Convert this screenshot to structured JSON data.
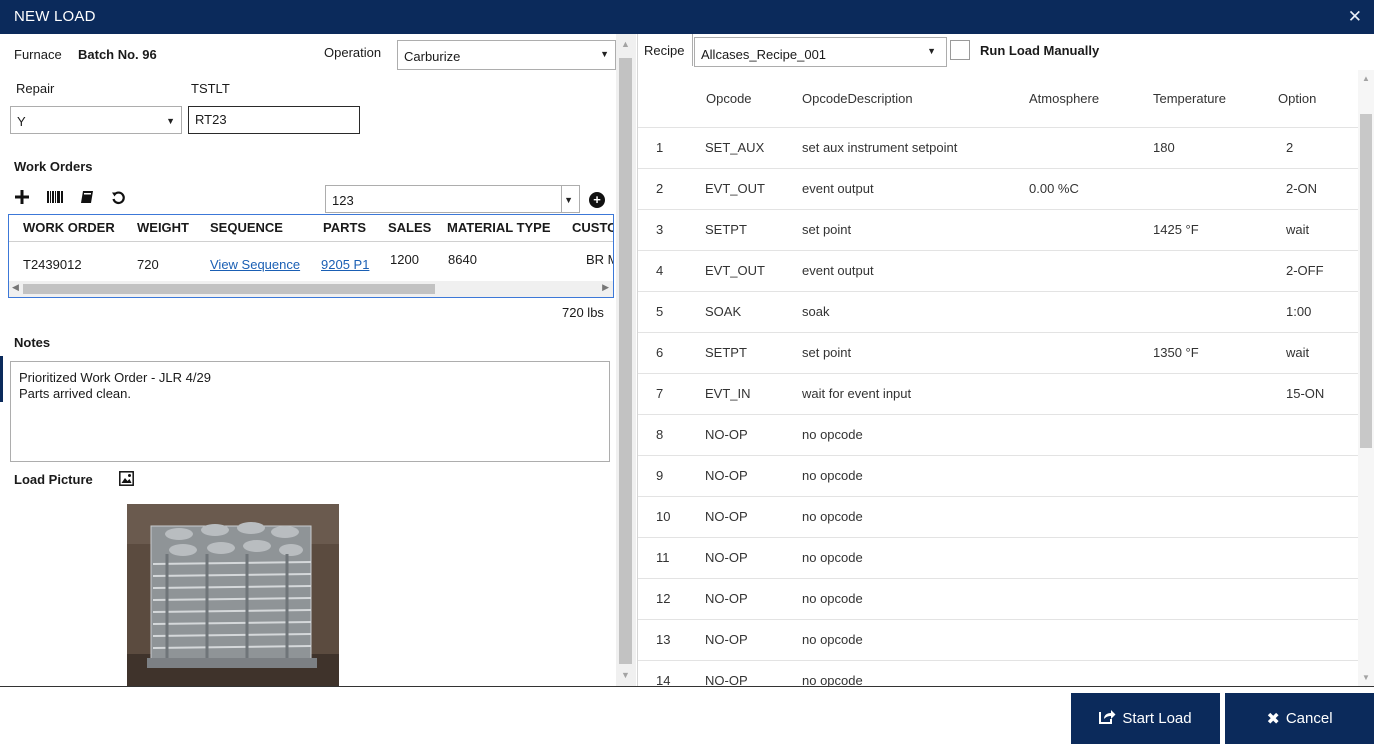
{
  "window": {
    "title": "NEW LOAD",
    "close_glyph": "✕"
  },
  "header": {
    "furnace_label": "Furnace",
    "batch": "Batch No. 96",
    "operation_label": "Operation",
    "operation_value": "Carburize",
    "repair_label": "Repair",
    "repair_value": "Y",
    "tstlt_label": "TSTLT",
    "tstlt_value": "RT23"
  },
  "work_orders": {
    "heading": "Work Orders",
    "toolbar_icons": [
      "add-icon",
      "barcode-icon",
      "book-icon",
      "refresh-icon"
    ],
    "search_value": "123",
    "columns": [
      "WORK ORDER",
      "WEIGHT",
      "SEQUENCE",
      "PARTS",
      "SALES",
      "MATERIAL TYPE",
      "CUSTO"
    ],
    "row": {
      "work_order": "T2439012",
      "weight": "720",
      "sequence": "View Sequence",
      "parts": "9205 P1",
      "sales": "1200",
      "material_type": "8640",
      "customer": "BR Ma"
    },
    "total_weight": "720 lbs"
  },
  "notes": {
    "heading": "Notes",
    "line1": "Prioritized Work Order - JLR 4/29",
    "line2": "Parts arrived clean."
  },
  "load_picture": {
    "heading": "Load Picture",
    "icon": "image-icon"
  },
  "recipe": {
    "label": "Recipe",
    "value": "Allcases_Recipe_001",
    "run_manual_label": "Run Load Manually",
    "run_manual_checked": false
  },
  "opcodes": {
    "columns": [
      "Opcode",
      "OpcodeDescription",
      "Atmosphere",
      "Temperature",
      "Option"
    ],
    "rows": [
      {
        "n": "1",
        "opcode": "SET_AUX",
        "desc": "set aux instrument setpoint",
        "atm": "",
        "temp": "180",
        "option": "2"
      },
      {
        "n": "2",
        "opcode": "EVT_OUT",
        "desc": "event output",
        "atm": "0.00 %C",
        "temp": "",
        "option": "2-ON"
      },
      {
        "n": "3",
        "opcode": "SETPT",
        "desc": "set point",
        "atm": "",
        "temp": "1425 °F",
        "option": "wait"
      },
      {
        "n": "4",
        "opcode": "EVT_OUT",
        "desc": "event output",
        "atm": "",
        "temp": "",
        "option": "2-OFF"
      },
      {
        "n": "5",
        "opcode": "SOAK",
        "desc": "soak",
        "atm": "",
        "temp": "",
        "option": "1:00"
      },
      {
        "n": "6",
        "opcode": "SETPT",
        "desc": "set point",
        "atm": "",
        "temp": "1350 °F",
        "option": "wait"
      },
      {
        "n": "7",
        "opcode": "EVT_IN",
        "desc": "wait for event input",
        "atm": "",
        "temp": "",
        "option": "15-ON"
      },
      {
        "n": "8",
        "opcode": "NO-OP",
        "desc": "no opcode",
        "atm": "",
        "temp": "",
        "option": ""
      },
      {
        "n": "9",
        "opcode": "NO-OP",
        "desc": "no opcode",
        "atm": "",
        "temp": "",
        "option": ""
      },
      {
        "n": "10",
        "opcode": "NO-OP",
        "desc": "no opcode",
        "atm": "",
        "temp": "",
        "option": ""
      },
      {
        "n": "11",
        "opcode": "NO-OP",
        "desc": "no opcode",
        "atm": "",
        "temp": "",
        "option": ""
      },
      {
        "n": "12",
        "opcode": "NO-OP",
        "desc": "no opcode",
        "atm": "",
        "temp": "",
        "option": ""
      },
      {
        "n": "13",
        "opcode": "NO-OP",
        "desc": "no opcode",
        "atm": "",
        "temp": "",
        "option": ""
      },
      {
        "n": "14",
        "opcode": "NO-OP",
        "desc": "no opcode",
        "atm": "",
        "temp": "",
        "option": ""
      }
    ]
  },
  "footer": {
    "start_label": "Start Load",
    "start_icon": "share-icon",
    "cancel_label": "Cancel",
    "cancel_icon": "close-icon"
  },
  "colors": {
    "primary": "#0b2a5b",
    "link": "#1a5fb4",
    "grid_border": "#3c78d8"
  }
}
